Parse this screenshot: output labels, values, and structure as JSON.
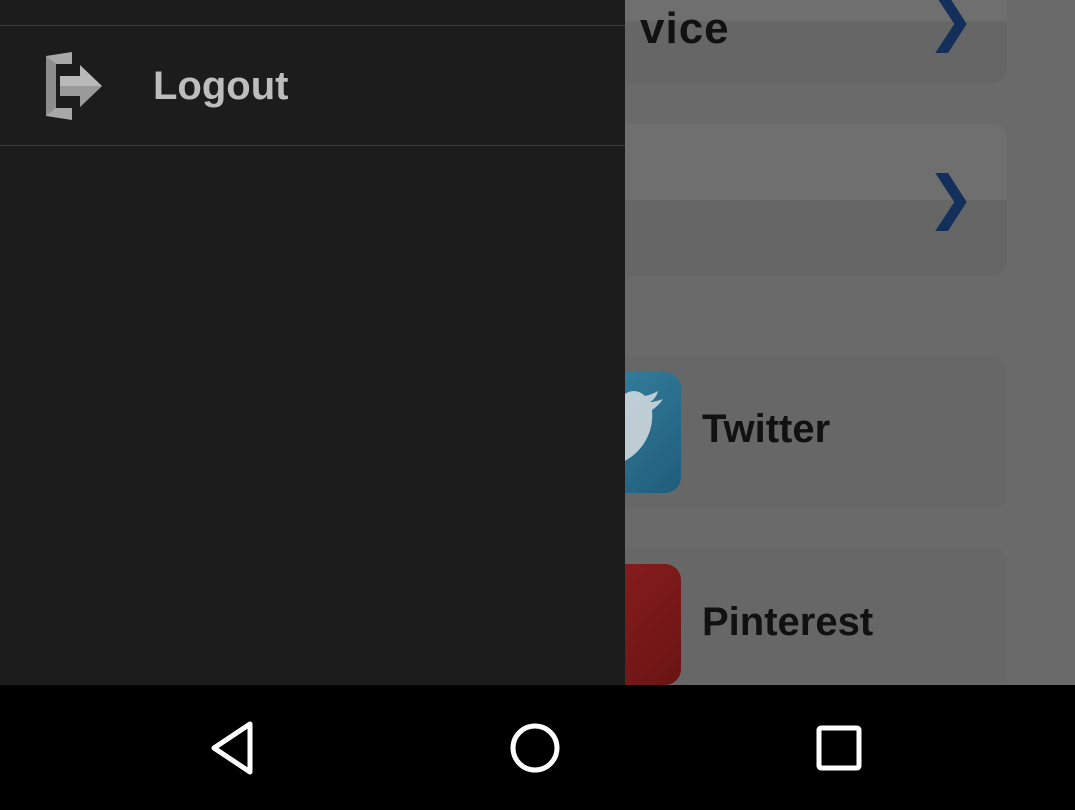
{
  "background": {
    "service_card_title": "vice",
    "social": [
      {
        "label": "Twitter",
        "icon": "twitter-icon",
        "color": "#2b7595"
      },
      {
        "label": "Pinterest",
        "icon": "pinterest-icon",
        "color": "#7e1a1a"
      }
    ],
    "chevron_glyph": "❯",
    "accent": "#14305a"
  },
  "drawer": {
    "items": [
      {
        "label": "Logout",
        "icon": "logout-icon"
      }
    ],
    "background": "#1c1c1c"
  },
  "navbar": {
    "buttons": [
      "back",
      "home",
      "recents"
    ]
  }
}
